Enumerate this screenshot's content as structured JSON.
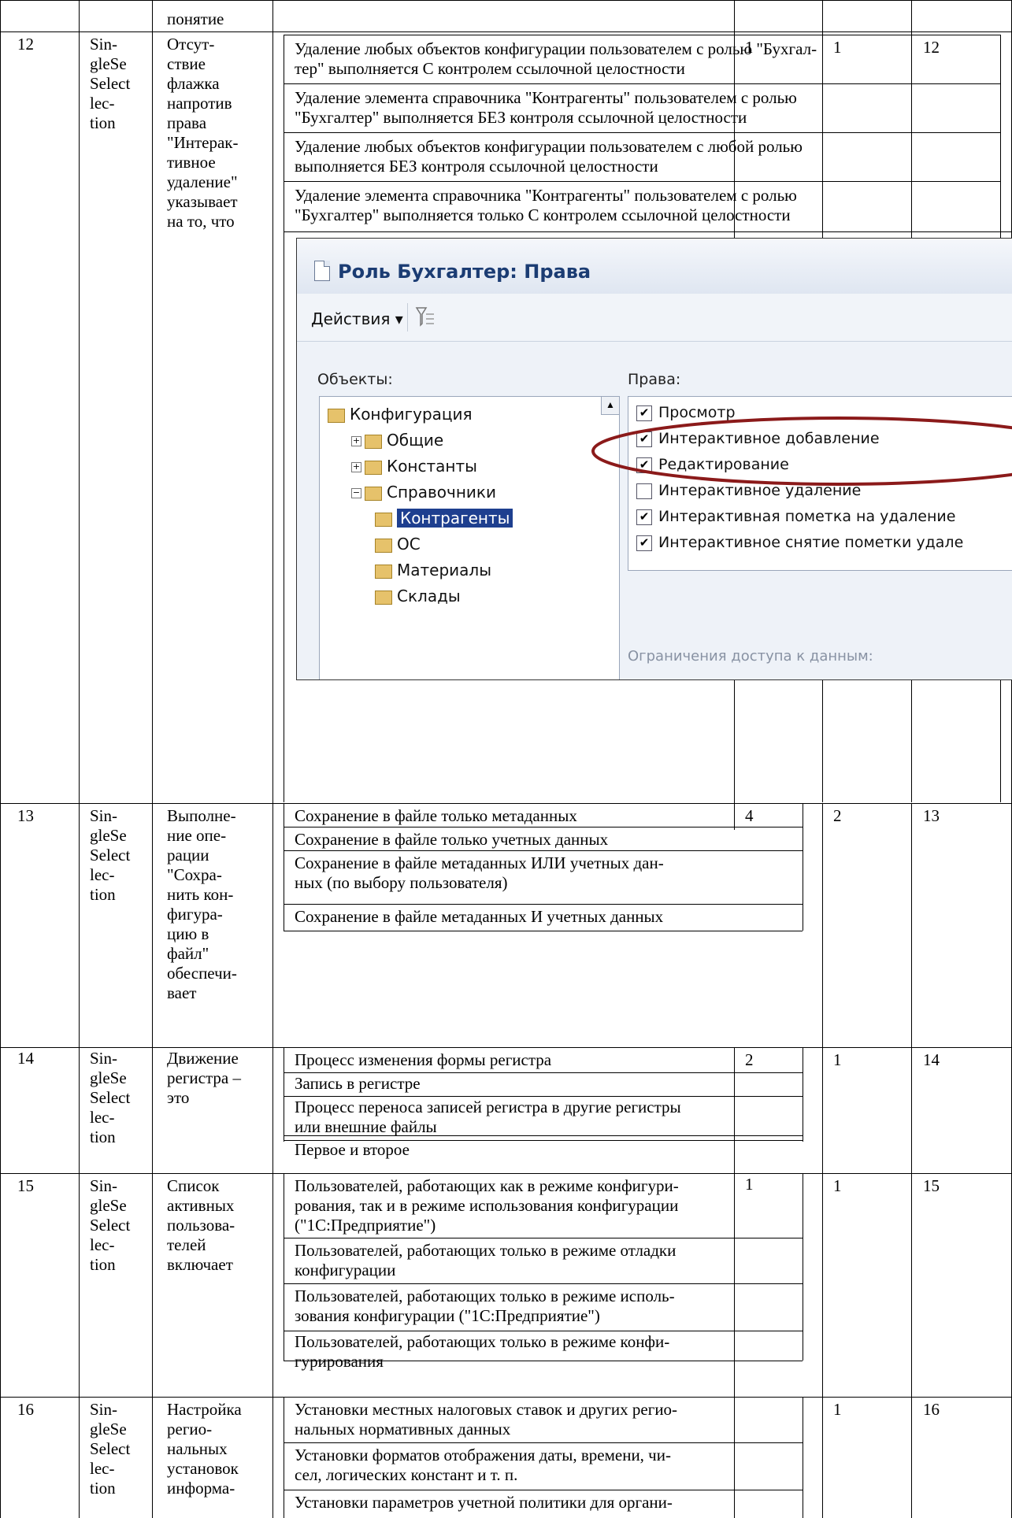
{
  "rows": [
    {
      "num": "12",
      "type": "Sin-\ngleSe\nSelect\nlec-\ntion",
      "question": "Отсут-\nствие\nфлажка\nнапротив\nправа\n\"Интерак-\nтивное\nудаление\"\nуказывает\nна то, что",
      "options": [
        "Удаление любых объектов конфигурации пользователем с ролью \"Бухгал-\nтер\" выполняется С контролем ссылочной целостности",
        "Удаление элемента справочника \"Контрагенты\" пользователем с ролью\n\"Бухгалтер\" выполняется БЕЗ контроля ссылочной целостности",
        "Удаление любых объектов конфигурации пользователем с любой ролью\nвыполняется БЕЗ контроля ссылочной целостности",
        "Удаление элемента справочника \"Контрагенты\" пользователем с ролью\n\"Бухгалтер\" выполняется только С контролем ссылочной целостности"
      ],
      "answer": "1",
      "points": "1",
      "qid": "12"
    },
    {
      "num": "13",
      "type": "Sin-\ngleSe\nSelect\nlec-\ntion",
      "question": "Выполне-\nние опе-\nрации\n\"Сохра-\nнить кон-\nфигура-\nцию в\nфайл\"\nобеспечи-\nвает",
      "options": [
        "Сохранение в файле только метаданных",
        "Сохранение в файле только учетных данных",
        "Сохранение в файле метаданных ИЛИ учетных дан-\nных (по выбору пользователя)",
        "Сохранение в файле метаданных И учетных данных"
      ],
      "answer": "4",
      "points": "2",
      "qid": "13"
    },
    {
      "num": "14",
      "type": "Sin-\ngleSe\nSelect\nlec-\ntion",
      "question": "Движение\nрегистра –\nэто",
      "options": [
        "Процесс изменения формы регистра",
        "Запись в регистре",
        "Процесс переноса записей регистра в другие регистры\nили внешние файлы",
        "Первое и второе"
      ],
      "answer": "2",
      "points": "1",
      "qid": "14"
    },
    {
      "num": "15",
      "type": "Sin-\ngleSe\nSelect\nlec-\ntion",
      "question": "Список\nактивных\nпользова-\nтелей\nвключает",
      "options": [
        "Пользователей, работающих как в режиме конфигури-\nрования, так и в режиме использования конфигурации\n(\"1С:Предприятие\")",
        "Пользователей, работающих только в режиме отладки\nконфигурации",
        "Пользователей, работающих только в режиме исполь-\nзования конфигурации (\"1С:Предприятие\")",
        "Пользователей, работающих только в режиме конфи-\nгурирования"
      ],
      "answer": "1",
      "points": "1",
      "qid": "15"
    },
    {
      "num": "16",
      "type": "Sin-\ngleSe\nSelect\nlec-\ntion",
      "question": "Настройка\nрегио-\nнальных\nустановок\nинформа-",
      "options": [
        "Установки местных налоговых ставок и других регио-\nнальных нормативных данных",
        "Установки форматов отображения даты, времени, чи-\nсел, логических констант и т. п.",
        "Установки параметров учетной политики для органи-"
      ],
      "answer": "",
      "points": "1",
      "qid": "16"
    }
  ],
  "top_fragment": "понятие",
  "screenshot": {
    "title": "Роль Бухгалтер: Права",
    "actions_label": "Действия ▾",
    "objects_label": "Объекты:",
    "rights_label": "Права:",
    "tree": [
      {
        "label": "Конфигурация",
        "depth": 0,
        "toggle": ""
      },
      {
        "label": "Общие",
        "depth": 1,
        "toggle": "+"
      },
      {
        "label": "Константы",
        "depth": 1,
        "toggle": "+"
      },
      {
        "label": "Справочники",
        "depth": 1,
        "toggle": "−"
      },
      {
        "label": "Контрагенты",
        "depth": 2,
        "toggle": "",
        "selected": true
      },
      {
        "label": "ОС",
        "depth": 2,
        "toggle": ""
      },
      {
        "label": "Материалы",
        "depth": 2,
        "toggle": ""
      },
      {
        "label": "Склады",
        "depth": 2,
        "toggle": ""
      }
    ],
    "rights": [
      {
        "label": "Просмотр",
        "checked": true
      },
      {
        "label": "Интерактивное добавление",
        "checked": true
      },
      {
        "label": "Редактирование",
        "checked": true
      },
      {
        "label": "Интерактивное удаление",
        "checked": false
      },
      {
        "label": "Интерактивная пометка на удаление",
        "checked": true
      },
      {
        "label": "Интерактивное снятие пометки удале",
        "checked": true
      }
    ],
    "restrict_label": "Ограничения доступа к данным:",
    "highlight_color": "#8b1a1a",
    "selection_color": "#1e3f8f"
  }
}
